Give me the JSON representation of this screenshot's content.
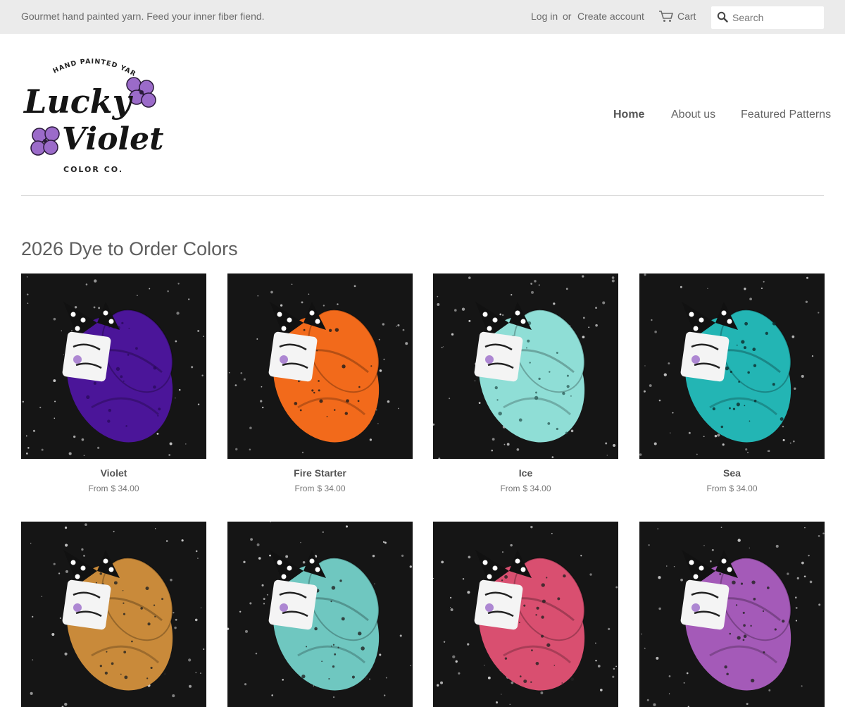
{
  "topbar": {
    "tagline": "Gourmet hand painted yarn. Feed your inner fiber fiend.",
    "login": "Log in",
    "or": "or",
    "create_account": "Create account",
    "cart": "Cart",
    "search_placeholder": "Search"
  },
  "logo": {
    "arc_text": "HAND PAINTED YARN",
    "line1": "Lucky",
    "line2": "Violet",
    "bottom": "COLOR CO."
  },
  "nav": {
    "home": "Home",
    "about": "About us",
    "patterns": "Featured Patterns"
  },
  "collection": {
    "title": "2026 Dye to Order Colors",
    "products": [
      {
        "name": "Violet",
        "from": "From",
        "price": "$ 34.00",
        "yarn_color": "#4b1599",
        "speckle": "#2a0a5e"
      },
      {
        "name": "Fire Starter",
        "from": "From",
        "price": "$ 34.00",
        "yarn_color": "#f26a1b",
        "speckle": "#1a1a1a"
      },
      {
        "name": "Ice",
        "from": "From",
        "price": "$ 34.00",
        "yarn_color": "#8fded6",
        "speckle": "#2f5f5b"
      },
      {
        "name": "Sea",
        "from": "From",
        "price": "$ 34.00",
        "yarn_color": "#23b5b4",
        "speckle": "#0d2b2b"
      }
    ],
    "row2_colors": [
      "#c98a3a",
      "#6fc7c0",
      "#d94f70",
      "#a45ab8"
    ]
  },
  "colors": {
    "topbar_bg": "#ebebeb",
    "logo_violet": "#9b6bc9"
  }
}
